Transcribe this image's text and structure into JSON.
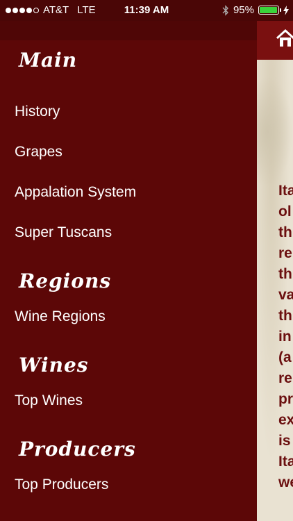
{
  "status_bar": {
    "signal_bars_filled": 4,
    "signal_bars_total": 5,
    "carrier": "AT&T",
    "network": "LTE",
    "time": "11:39 AM",
    "bluetooth_icon": "bluetooth-icon",
    "battery_percent": "95%",
    "battery_level": 0.95,
    "charging_icon": "bolt-icon",
    "battery_color": "#3ad23a"
  },
  "menu": {
    "sections": [
      {
        "title": "Main",
        "items": [
          "History",
          "Grapes",
          "Appalation System",
          "Super Tuscans"
        ]
      },
      {
        "title": "Regions",
        "items": [
          "Wine Regions"
        ]
      },
      {
        "title": "Wines",
        "items": [
          "Top Wines"
        ]
      },
      {
        "title": "Producers",
        "items": [
          "Top Producers"
        ]
      }
    ],
    "background_color": "#5c0707"
  },
  "content": {
    "home_icon": "home-icon",
    "body_text_fragments": [
      "Ita",
      "ol",
      "th",
      "re",
      "th",
      "va",
      "th",
      "in",
      "(a",
      "re",
      "pr",
      "ex",
      "is",
      "Ita",
      "we"
    ],
    "text_color": "#6b0f0f"
  }
}
